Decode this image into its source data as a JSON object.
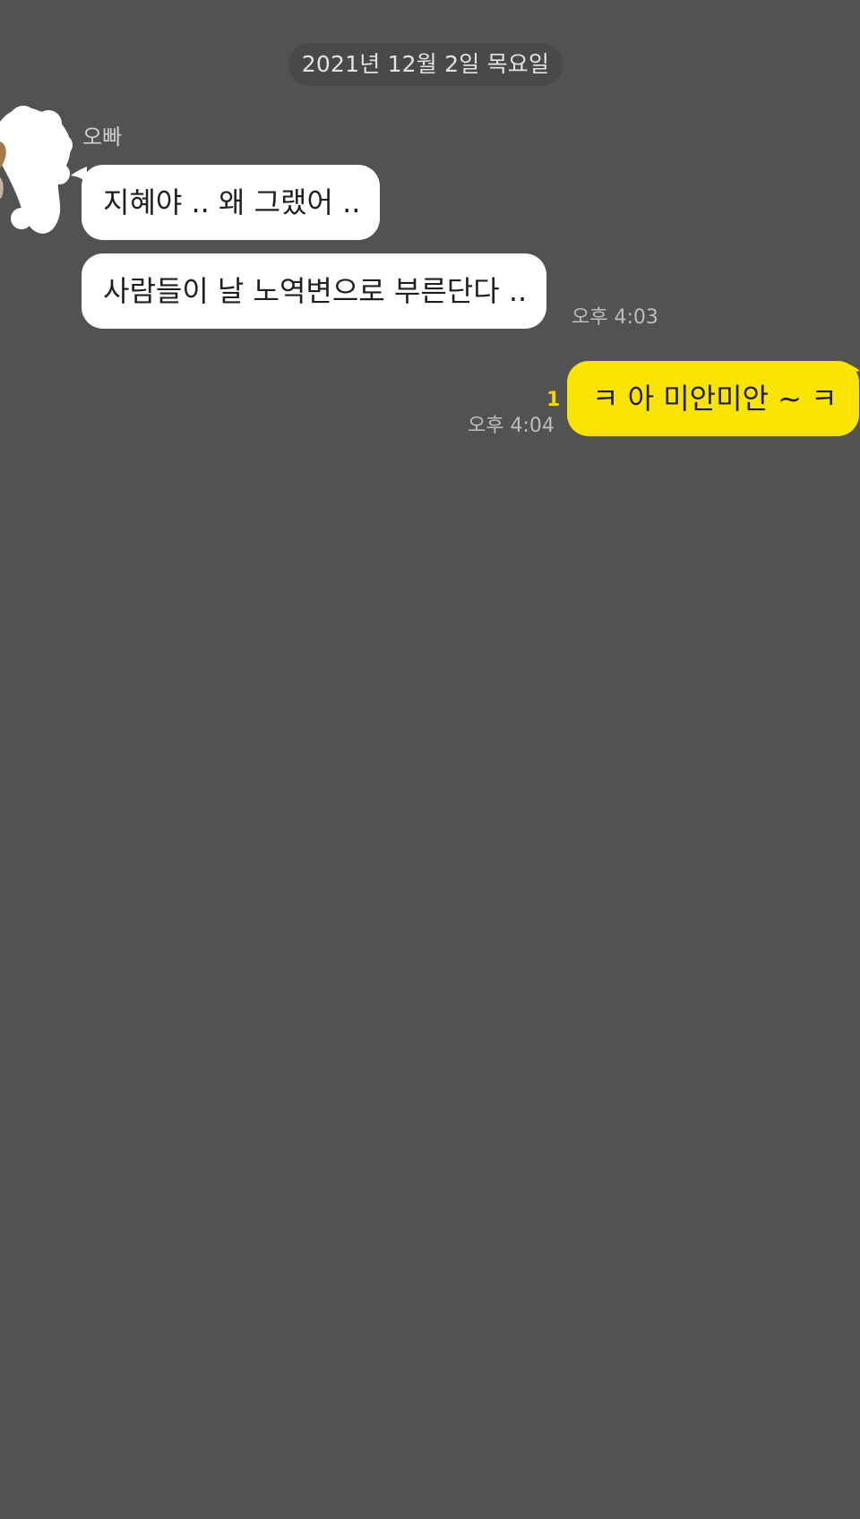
{
  "chat": {
    "date_divider": "2021년 12월 2일 목요일",
    "sender": {
      "name": "오빠",
      "avatar": "blurred-profile-photo-icon"
    },
    "messages": [
      {
        "text": "지혜야 .. 왜 그랬어 .."
      },
      {
        "text": "사람들이 날 노역변으로 부른단다 ..",
        "time": "오후 4:03"
      },
      {
        "text": "ㅋ 아 미안미안 ~ ㅋ",
        "time": "오후 4:04",
        "unread_count": "1"
      }
    ],
    "colors": {
      "background": "#535253",
      "incoming_bubble": "#ffffff",
      "outgoing_bubble": "#fbe400",
      "unread_count": "#f5d400"
    }
  }
}
